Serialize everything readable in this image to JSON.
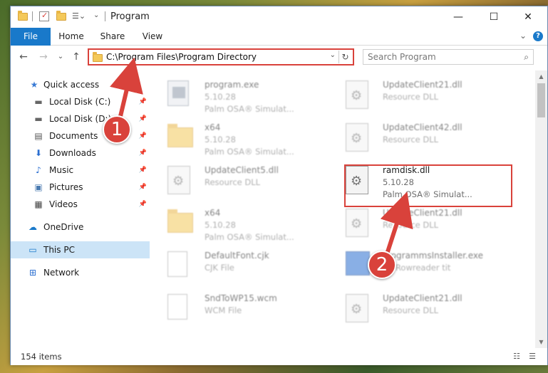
{
  "window": {
    "title": "Program",
    "controls": {
      "minimize": "—",
      "maximize": "☐",
      "close": "✕"
    }
  },
  "ribbon": {
    "tabs": [
      {
        "label": "File"
      },
      {
        "label": "Home"
      },
      {
        "label": "Share"
      },
      {
        "label": "View"
      }
    ],
    "expand": "⌄",
    "help": "?"
  },
  "navigation": {
    "back": "←",
    "forward": "→",
    "recent": "⌄",
    "up": "↑",
    "address": "C:\\Program Files\\Program Directory",
    "dropdown": "⌄",
    "refresh": "↻",
    "search_placeholder": "Search Program",
    "search_icon": "⌕"
  },
  "sidebar": {
    "items": [
      {
        "label": "Quick access",
        "icon": "★",
        "icon_name": "quick-access-star-icon",
        "color": "#3a7bd5"
      },
      {
        "label": "Local Disk (C:)",
        "icon": "▬",
        "icon_name": "drive-icon",
        "color": "#666666",
        "pin": "📌"
      },
      {
        "label": "Local Disk (D:)",
        "icon": "▬",
        "icon_name": "drive-icon",
        "color": "#666666",
        "pin": "📌"
      },
      {
        "label": "Documents",
        "icon": "▤",
        "icon_name": "documents-icon",
        "color": "#555555",
        "pin": "📌"
      },
      {
        "label": "Downloads",
        "icon": "⬇",
        "icon_name": "downloads-icon",
        "color": "#2a6ed0",
        "pin": "📌"
      },
      {
        "label": "Music",
        "icon": "♪",
        "icon_name": "music-icon",
        "color": "#2a6ed0",
        "pin": "📌"
      },
      {
        "label": "Pictures",
        "icon": "▣",
        "icon_name": "pictures-icon",
        "color": "#4a7ab0",
        "pin": "📌"
      },
      {
        "label": "Videos",
        "icon": "▦",
        "icon_name": "videos-icon",
        "color": "#444444",
        "pin": "📌"
      },
      {
        "label": "OneDrive",
        "icon": "☁",
        "icon_name": "onedrive-cloud-icon",
        "color": "#1979ca"
      },
      {
        "label": "This PC",
        "icon": "▭",
        "icon_name": "this-pc-icon",
        "color": "#1979ca"
      },
      {
        "label": "Network",
        "icon": "⊞",
        "icon_name": "network-icon",
        "color": "#2a6ed0"
      }
    ]
  },
  "files": [
    {
      "name": "program.exe",
      "line2": "5.10.28",
      "line3": "Palm OSA® Simulat...",
      "icon": "exe"
    },
    {
      "name": "UpdateClient21.dll",
      "line2": "Resource DLL",
      "line3": "",
      "icon": "dll"
    },
    {
      "name": "x64",
      "line2": "5.10.28",
      "line3": "Palm OSA® Simulat...",
      "icon": "folder"
    },
    {
      "name": "UpdateClient42.dll",
      "line2": "Resource DLL",
      "line3": "",
      "icon": "dll"
    },
    {
      "name": "UpdateClient5.dll",
      "line2": "Resource DLL",
      "line3": "",
      "icon": "dll"
    },
    {
      "name": "ramdisk.dll",
      "line2": "5.10.28",
      "line3": "Palm OSA® Simulat...",
      "icon": "dll"
    },
    {
      "name": "x64",
      "line2": "5.10.28",
      "line3": "Palm OSA® Simulat...",
      "icon": "folder"
    },
    {
      "name": "UpdateClient21.dll",
      "line2": "Resource DLL",
      "line3": "",
      "icon": "dll"
    },
    {
      "name": "DefaultFont.cjk",
      "line2": "CJK File",
      "line3": "",
      "icon": "text"
    },
    {
      "name": "ProgrammsInstaller.exe",
      "line2": "BY Rowreader tit",
      "line3": "",
      "icon": "installer"
    },
    {
      "name": "SndToWP15.wcm",
      "line2": "WCM File",
      "line3": "",
      "icon": "text"
    },
    {
      "name": "UpdateClient21.dll",
      "line2": "Resource DLL",
      "line3": "",
      "icon": "dll"
    }
  ],
  "status": {
    "count": "154 items",
    "details_view": "☷",
    "tiles_view": "☰"
  },
  "callouts": {
    "first": "1",
    "second": "2"
  },
  "colors": {
    "accent": "#1979ca",
    "highlight": "#d9423b",
    "selected": "#cce4f7"
  }
}
